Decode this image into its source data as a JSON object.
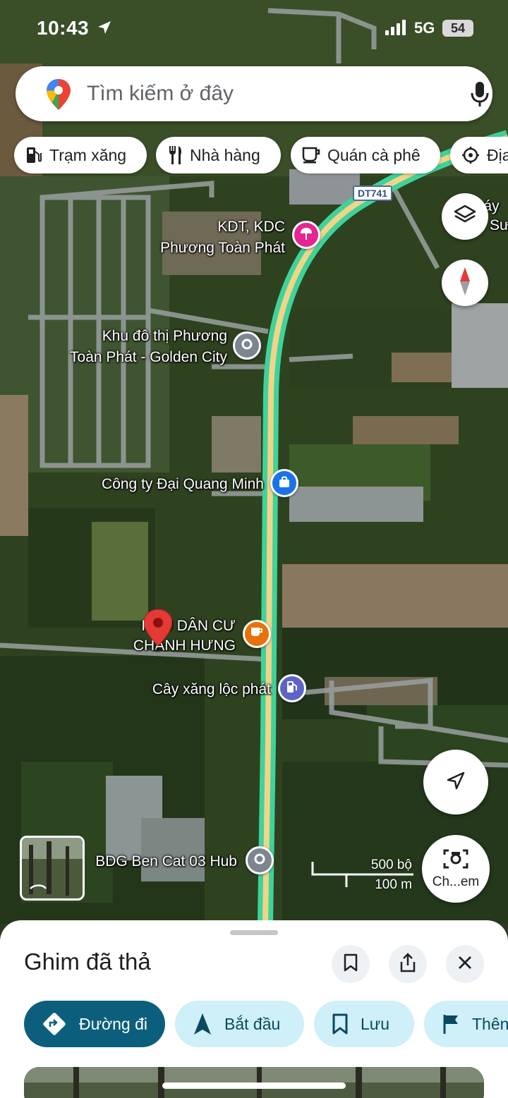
{
  "status_bar": {
    "time": "10:43",
    "network": "5G",
    "battery": "54"
  },
  "search": {
    "placeholder": "Tìm kiếm ở đây"
  },
  "chips": [
    {
      "label": "Trạm xăng",
      "icon": "gas-station-icon"
    },
    {
      "label": "Nhà hàng",
      "icon": "fork-knife-icon"
    },
    {
      "label": "Quán cà phê",
      "icon": "coffee-cup-icon"
    },
    {
      "label": "Địa",
      "icon": "attraction-icon"
    }
  ],
  "map": {
    "route_shield": "DT741",
    "places": {
      "kdt_l1": "KDT, KDC",
      "kdt_l2": "Phương Toàn Phát",
      "khu_l1": "Khu đô thị Phương",
      "khu_l2": "Toàn Phát - Golden City",
      "company": "Công ty Đại Quang Minh",
      "kdc_l1": "KHU DÂN CƯ",
      "kdc_l2": "CHÁNH HƯNG",
      "gas": "Cây xăng lộc phát",
      "hub": "BDG Ben Cat 03 Hub",
      "edge_l1": "máy",
      "edge_l2": "Sư"
    },
    "scale": {
      "imperial": "500 bộ",
      "metric": "100 m"
    },
    "camera_label": "Ch...em",
    "colors": {
      "route": "#3ed39a",
      "road_center": "#f2d38a",
      "pin": "#e53935"
    }
  },
  "sheet": {
    "title": "Ghim đã thả",
    "actions": [
      {
        "label": "Đường đi",
        "icon": "directions-icon"
      },
      {
        "label": "Bắt đầu",
        "icon": "navigation-arrow-icon"
      },
      {
        "label": "Lưu",
        "icon": "bookmark-icon"
      },
      {
        "label": "Thên",
        "icon": "flag-icon"
      }
    ]
  }
}
